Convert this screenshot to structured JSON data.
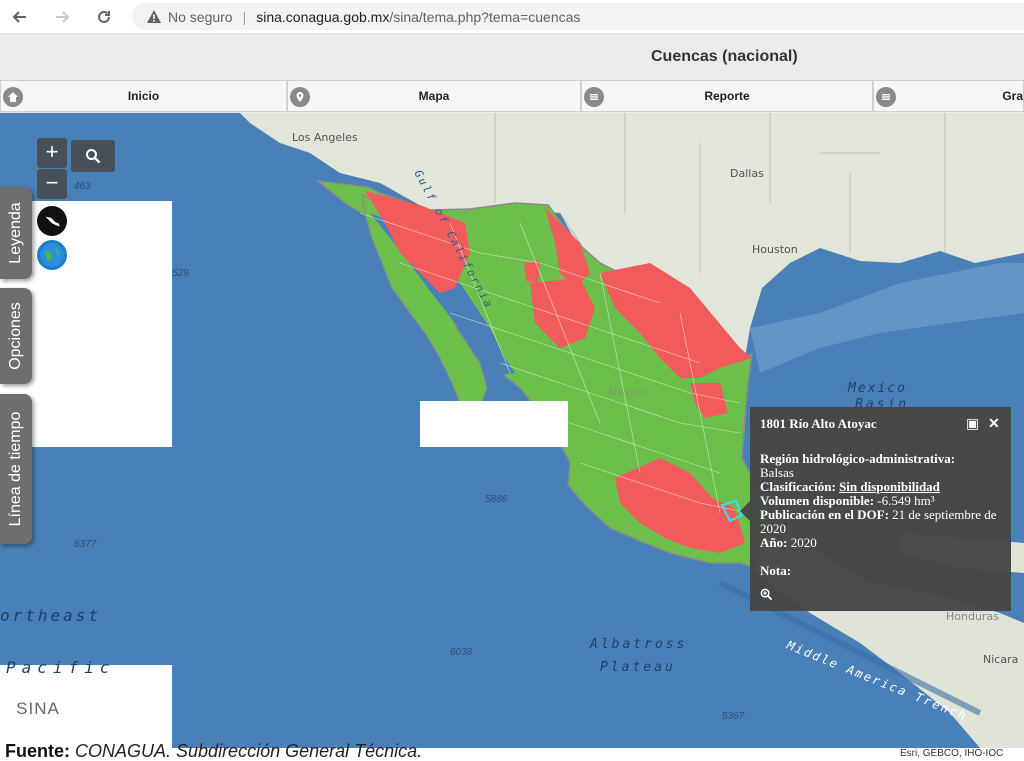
{
  "browser": {
    "insecure_label": "No seguro",
    "url_host": "sina.conagua.gob.mx",
    "url_path": "/sina/tema.php?tema=cuencas"
  },
  "app": {
    "title": "Cuencas (nacional)",
    "menu": [
      {
        "label": "Inicio",
        "icon": "home-icon"
      },
      {
        "label": "Mapa",
        "icon": "map-pin-icon"
      },
      {
        "label": "Reporte",
        "icon": "list-icon"
      },
      {
        "label": "Gra",
        "icon": "list-icon"
      }
    ]
  },
  "map": {
    "zoom_in": "+",
    "zoom_out": "−",
    "side_tabs": [
      "Leyenda",
      "Opciones",
      "Línea de tiempo"
    ],
    "city_labels": [
      "Los Angeles",
      "Dallas",
      "Houston",
      "Mexico"
    ],
    "gulf_label": "Gulf of California",
    "ocean_labels": [
      "ortheast",
      "Pacific",
      "Albatross",
      "Plateau",
      "Mexico",
      "Basin",
      "Middle America Trench"
    ],
    "depth_labels": [
      "463",
      "529",
      "5886",
      "6377",
      "6038",
      "5367"
    ],
    "edge_labels": [
      "Nicara",
      "Honduras"
    ],
    "logo_text": "SINA",
    "attribution": "Esri, GEBCO, IHO-IOC"
  },
  "popup": {
    "title": "1801 Río Alto Atoyac",
    "region_label": "Región hidrológico-administrativa:",
    "region_value": "Balsas",
    "clasif_label": "Clasificación:",
    "clasif_value": "Sin disponibilidad",
    "volumen_label": "Volumen disponible:",
    "volumen_value": "-6.549 hm³",
    "dof_label": "Publicación en el DOF:",
    "dof_value": "21 de septiembre de 2020",
    "anio_label": "Año:",
    "anio_value": "2020",
    "nota_label": "Nota:"
  },
  "footer": {
    "fuente_label": "Fuente:",
    "fuente_value": "CONAGUA. Subdirección General Técnica."
  },
  "colors": {
    "available": "#6dbf4b",
    "deficit": "#f25b5b",
    "ocean": "#4a80b8",
    "land": "#dfe3d8"
  }
}
